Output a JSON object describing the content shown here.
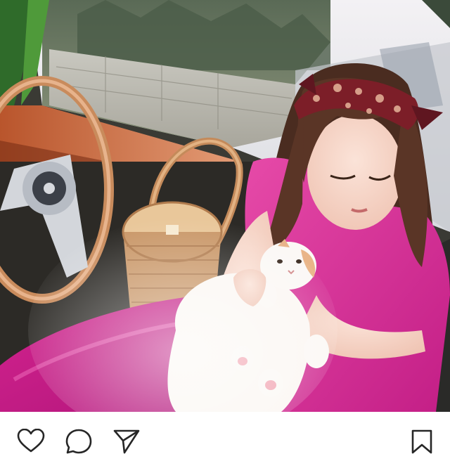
{
  "post": {
    "photo_icon": "photo-image",
    "actions": {
      "like_icon": "heart-icon",
      "comment_icon": "comment-icon",
      "share_icon": "send-icon",
      "save_icon": "bookmark-icon"
    },
    "colors": {
      "icon_stroke": "#262626",
      "background": "#ffffff"
    }
  }
}
